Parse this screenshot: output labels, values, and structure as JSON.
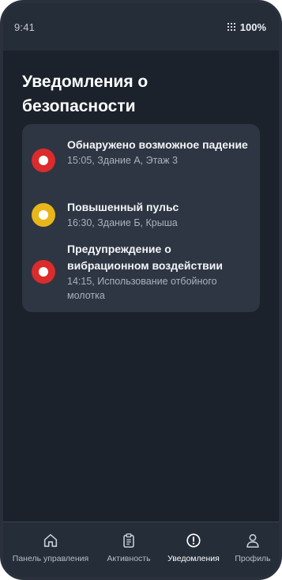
{
  "status_bar": {
    "time": "9:41",
    "battery": "100%"
  },
  "page": {
    "title": "Уведомления о безопасности"
  },
  "alerts": [
    {
      "title": "Обнаружено возможное падение",
      "meta": "15:05, Здание А, Этаж 3",
      "severity": "red",
      "color": "#dc2b2b",
      "icon": "alert-dot-icon"
    },
    {
      "title": "Повышенный пульс",
      "meta": "16:30, Здание Б, Крыша",
      "severity": "yellow",
      "color": "#e8b61a",
      "icon": "alert-dot-icon"
    },
    {
      "title": "Предупреждение о вибрационном воздействии",
      "meta": "14:15, Использование отбойного молотка",
      "severity": "red",
      "color": "#dc2b2b",
      "icon": "alert-dot-icon"
    }
  ],
  "nav": {
    "items": [
      {
        "label": "Панель управления",
        "icon": "home-icon"
      },
      {
        "label": "Активность",
        "icon": "clipboard-icon"
      },
      {
        "label": "Уведомления",
        "icon": "alert-circle-icon",
        "active": true
      },
      {
        "label": "Профиль",
        "icon": "user-icon"
      }
    ]
  }
}
